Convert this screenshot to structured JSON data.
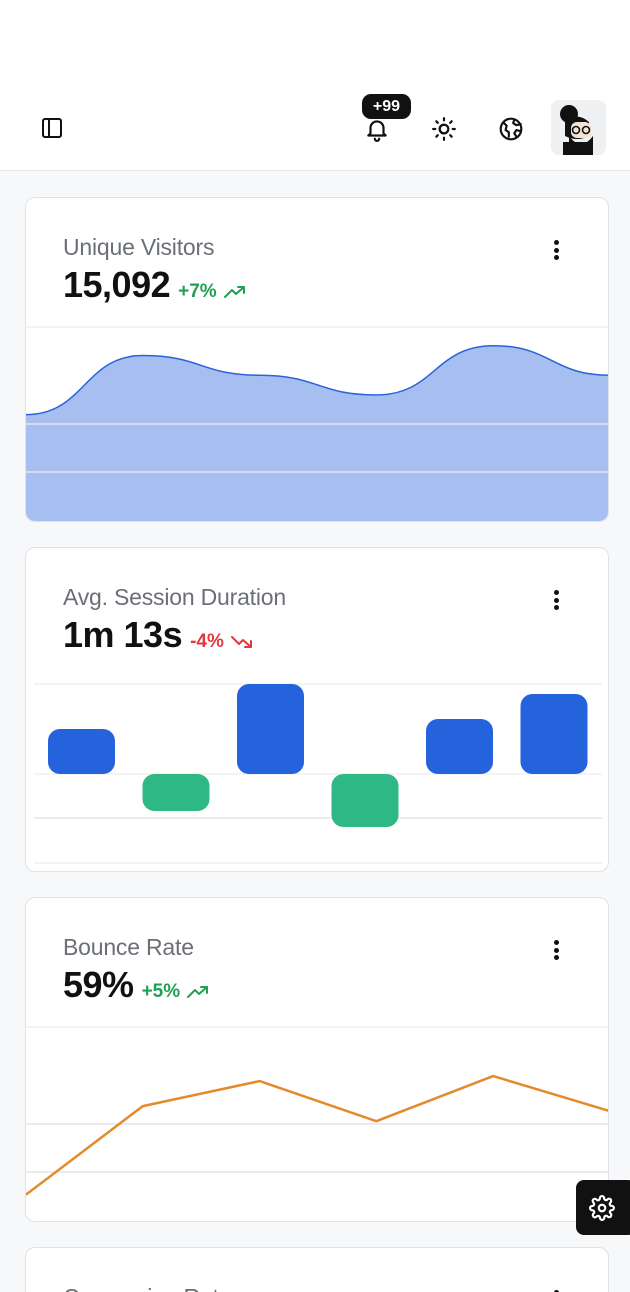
{
  "header": {
    "notification_badge": "+99",
    "icons": [
      "sidebar-toggle-icon",
      "bell-icon",
      "theme-toggle-icon",
      "globe-icon",
      "avatar"
    ]
  },
  "cards": [
    {
      "title": "Unique Visitors",
      "value": "15,092",
      "delta": "+7%",
      "trend": "up",
      "color": "#a6bff0",
      "line_color": "#2b62db",
      "chart_data": {
        "type": "area",
        "x": [
          0,
          1,
          2,
          3,
          4,
          5
        ],
        "values": [
          2.2,
          3.4,
          3.0,
          2.6,
          3.6,
          3.0
        ]
      }
    },
    {
      "title": "Avg. Session Duration",
      "value": "1m 13s",
      "delta": "-4%",
      "trend": "down",
      "positive_color": "#2563dd",
      "negative_color": "#2eb886",
      "chart_data": {
        "type": "bar",
        "categories": [
          "1",
          "2",
          "3",
          "4",
          "5",
          "6"
        ],
        "values": [
          45,
          -37,
          90,
          -53,
          55,
          80
        ]
      }
    },
    {
      "title": "Bounce Rate",
      "value": "59%",
      "delta": "+5%",
      "trend": "up",
      "line_color": "#e38b2c",
      "chart_data": {
        "type": "line",
        "x": [
          0,
          1,
          2,
          3,
          4,
          5
        ],
        "values": [
          0.0,
          1.06,
          1.36,
          0.88,
          1.42,
          1.0
        ]
      }
    },
    {
      "title": "Conversion Rate"
    }
  ],
  "settings_fab": "gear-icon"
}
